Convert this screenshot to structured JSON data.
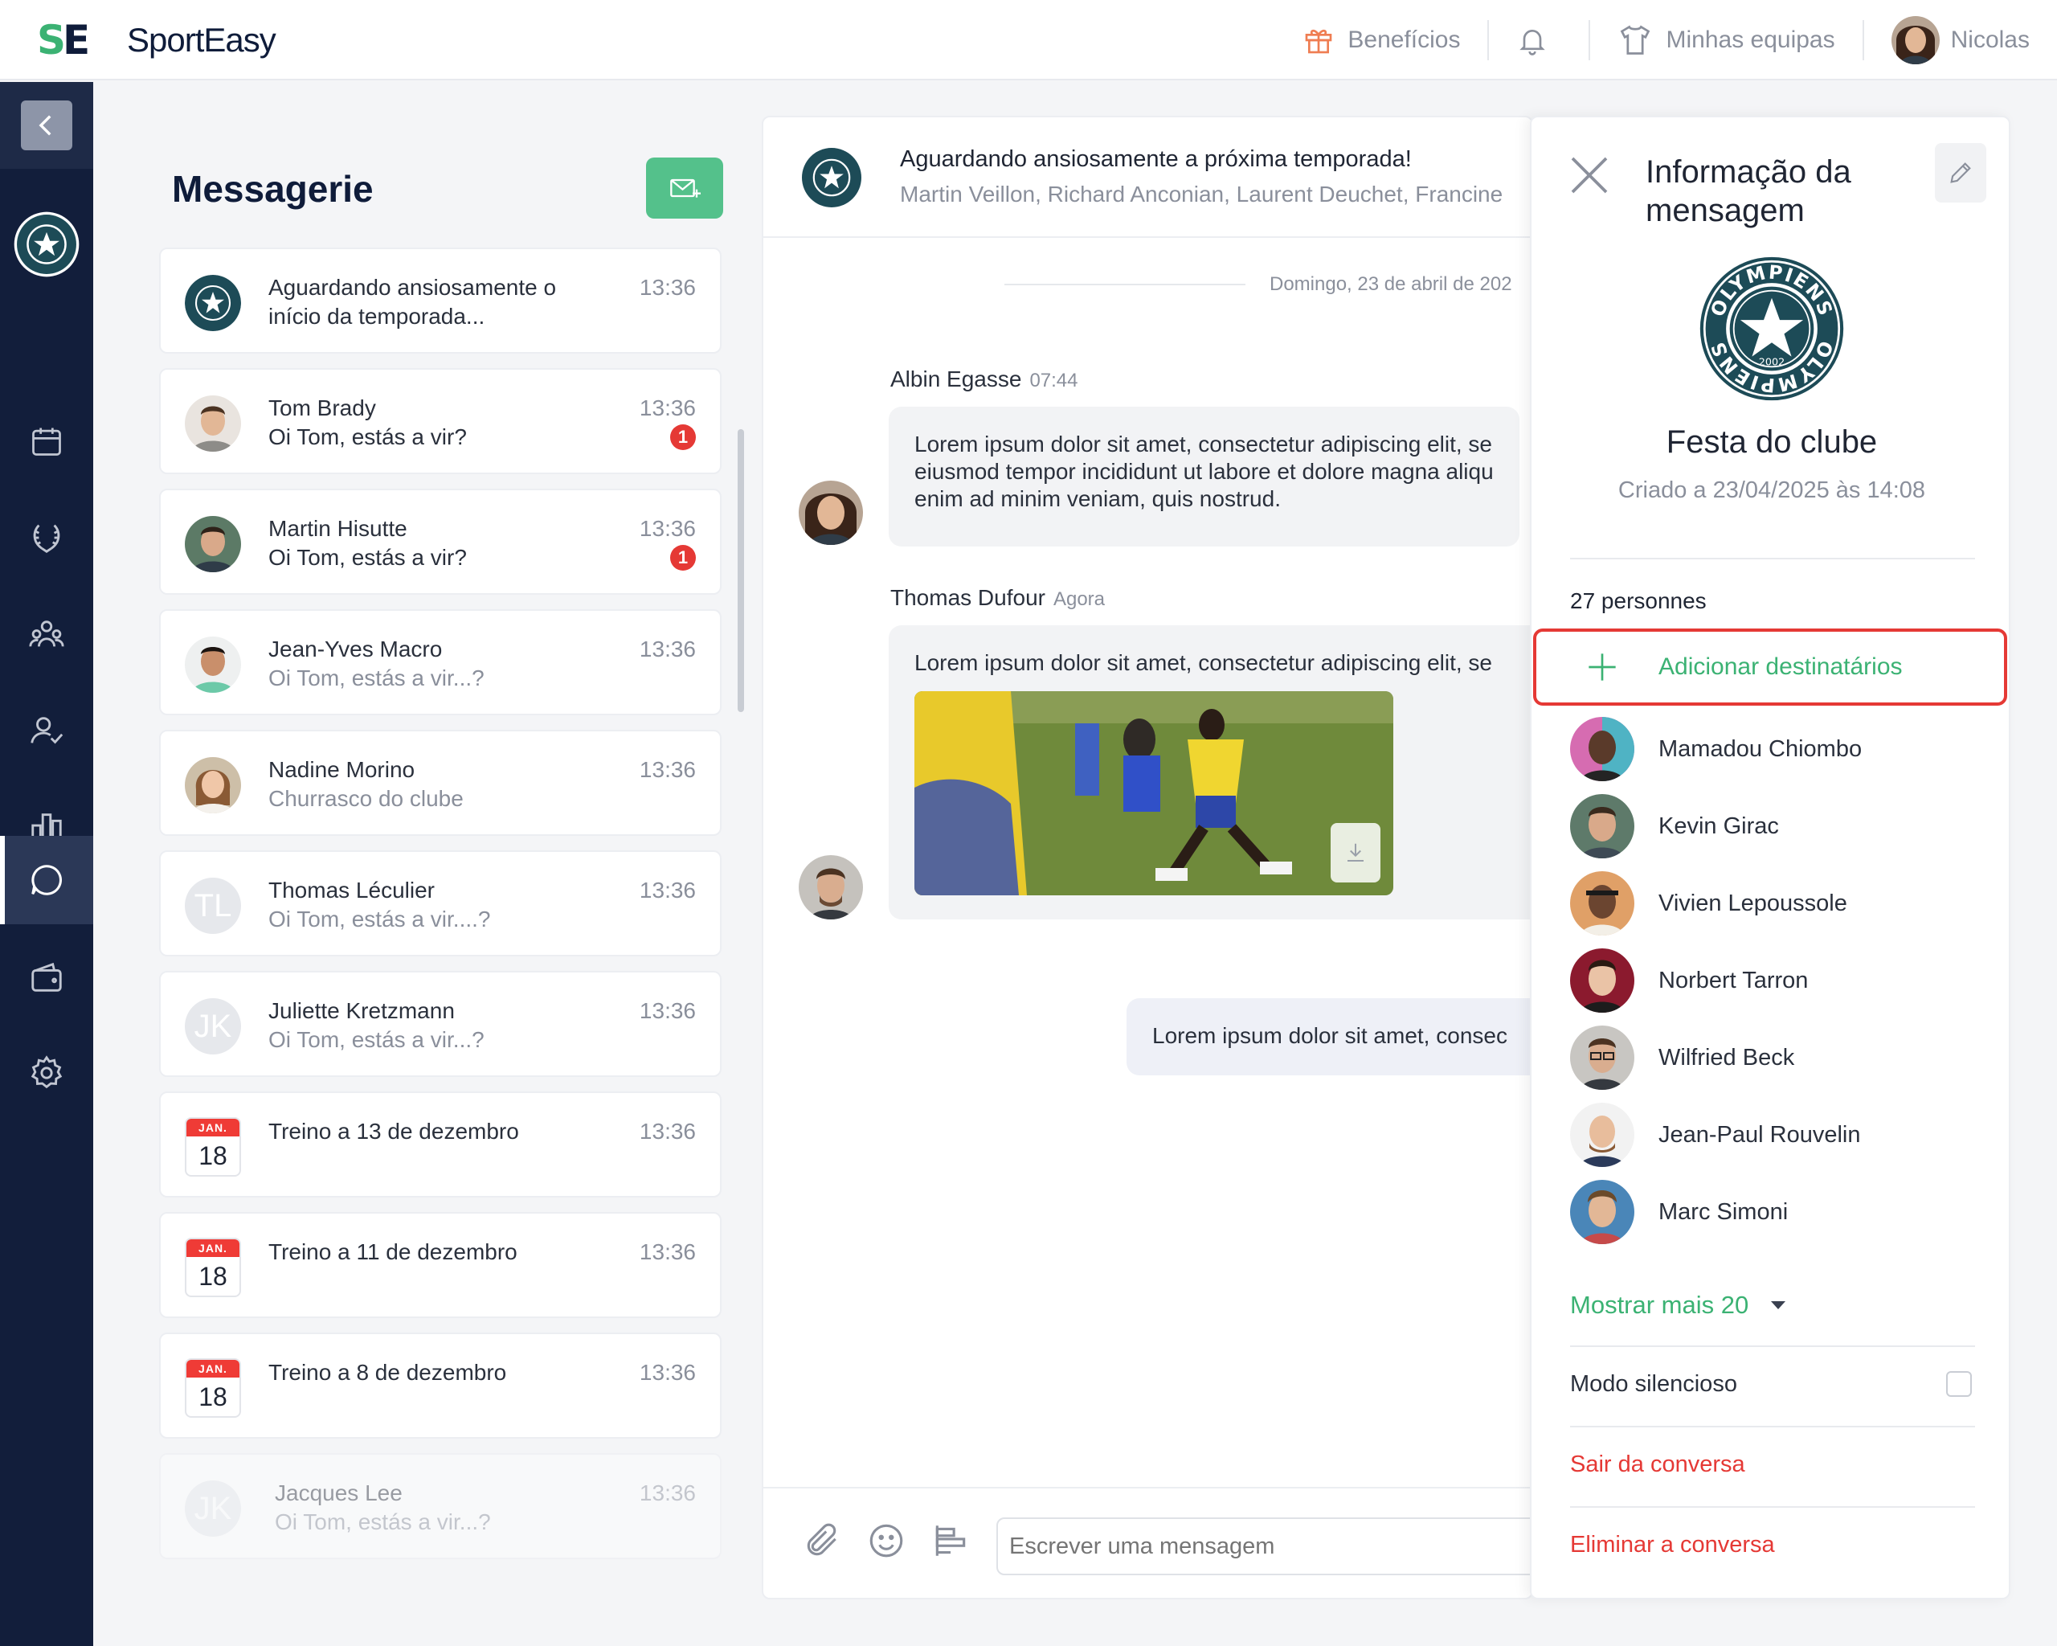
{
  "app": {
    "brand": "SportEasy",
    "logo_letters": "SE"
  },
  "topnav": {
    "benefits": "Benefícios",
    "notifications_icon": "bell-icon",
    "teams": "Minhas equipas",
    "user": "Nicolas"
  },
  "sidebar": {
    "icons": [
      "back-arrow-icon",
      "club-badge",
      "calendar-icon",
      "laurel-icon",
      "team-icon",
      "user-check-icon",
      "stats-icon",
      "chat-icon",
      "wallet-icon",
      "gear-icon"
    ],
    "active": "chat-icon"
  },
  "messagerie": {
    "title": "Messagerie",
    "compose_icon": "envelope-plus-icon",
    "conversations": [
      {
        "title": "Aguardando ansiosamente o",
        "preview": "início da temporada...",
        "time": "13:36",
        "avatar": "club"
      },
      {
        "title": "Tom Brady",
        "preview": "Oi Tom, estás a vir?",
        "time": "13:36",
        "unread": "1"
      },
      {
        "title": "Martin Hisutte",
        "preview": "Oi Tom, estás a vir?",
        "time": "13:36",
        "unread": "1"
      },
      {
        "title": "Jean-Yves Macro",
        "preview": "Oi Tom, estás a vir...?",
        "time": "13:36"
      },
      {
        "title": "Nadine Morino",
        "preview": "Churrasco do clube",
        "time": "13:36"
      },
      {
        "title": "Thomas Léculier",
        "preview": "Oi Tom, estás a vir....?",
        "time": "13:36",
        "initials": "TL"
      },
      {
        "title": "Juliette Kretzmann",
        "preview": "Oi Tom, estás a vir...?",
        "time": "13:36",
        "initials": "JK"
      },
      {
        "title": "Treino a 13 de dezembro",
        "time": "13:36",
        "cal_month": "JAN.",
        "cal_day": "18"
      },
      {
        "title": "Treino a 11 de dezembro",
        "time": "13:36",
        "cal_month": "JAN.",
        "cal_day": "18"
      },
      {
        "title": "Treino a 8 de dezembro",
        "time": "13:36",
        "cal_month": "JAN.",
        "cal_day": "18"
      },
      {
        "title": "Jacques Lee",
        "preview": "Oi Tom, estás a vir...?",
        "time": "13:36",
        "initials": "JK"
      }
    ]
  },
  "chat": {
    "header_title": "Aguardando ansiosamente a próxima temporada!",
    "header_members": "Martin Veillon, Richard Anconian, Laurent Deuchet, Francine",
    "date_separator": "Domingo, 23 de abril de 202",
    "messages": [
      {
        "author": "Albin Egasse",
        "time": "07:44",
        "lines": [
          "Lorem ipsum dolor sit amet, consectetur adipiscing elit, se",
          "eiusmod tempor incididunt ut labore et dolore magna aliqu",
          "enim ad minim veniam, quis nostrud."
        ]
      },
      {
        "author": "Thomas Dufour",
        "time": "Agora",
        "lines": [
          "Lorem ipsum dolor sit amet, consectetur adipiscing elit, se"
        ]
      },
      {
        "author": "",
        "time": "",
        "lines": [
          "Lorem ipsum dolor sit amet, consec"
        ]
      }
    ],
    "composer_placeholder": "Escrever uma mensagem"
  },
  "info": {
    "title": "Informação da mensagem",
    "club_name_line1": "OLYMPIENS",
    "club_year": "2002",
    "group_name": "Festa do clube",
    "created": "Criado a 23/04/2025 às 14:08",
    "count": "27 personnes",
    "add_label": "Adicionar destinatários",
    "members": [
      "Mamadou Chiombo",
      "Kevin Girac",
      "Vivien Lepoussole",
      "Norbert Tarron",
      "Wilfried Beck",
      "Jean-Paul Rouvelin",
      "Marc Simoni"
    ],
    "show_more": "Mostrar mais 20",
    "silent_mode": "Modo silencioso",
    "leave": "Sair da conversa",
    "delete": "Eliminar a conversa"
  },
  "colors": {
    "accent_green": "#3bb273",
    "sidebar_navy": "#121e3b",
    "danger_red": "#e53935"
  }
}
